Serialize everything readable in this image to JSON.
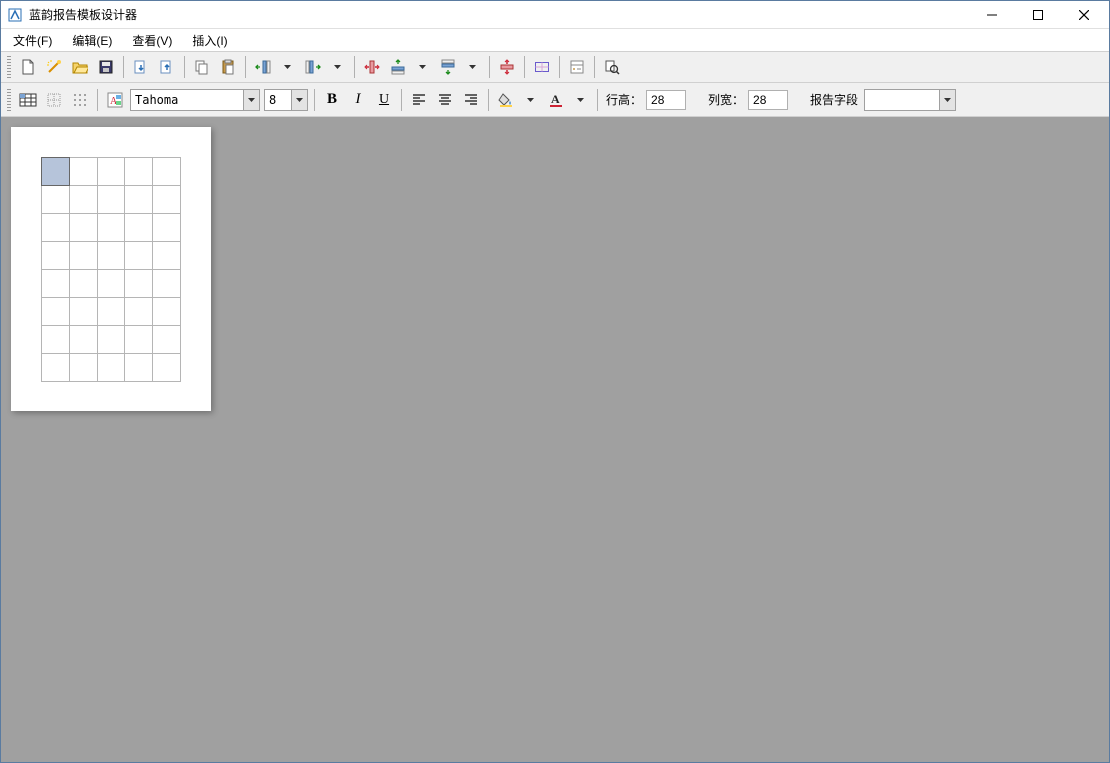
{
  "window": {
    "title": "蓝韵报告模板设计器"
  },
  "menu": {
    "file": "文件(F)",
    "edit": "编辑(E)",
    "view": "查看(V)",
    "insert": "插入(I)"
  },
  "toolbar2": {
    "font_name": "Tahoma",
    "font_size": "8",
    "bold": "B",
    "italic": "I",
    "underline": "U",
    "row_height_label": "行高：",
    "row_height_value": "28",
    "col_width_label": "列宽：",
    "col_width_value": "28",
    "report_field_label": "报告字段",
    "report_field_value": ""
  },
  "grid": {
    "rows": 8,
    "cols": 5,
    "selected_row": 0,
    "selected_col": 0
  }
}
